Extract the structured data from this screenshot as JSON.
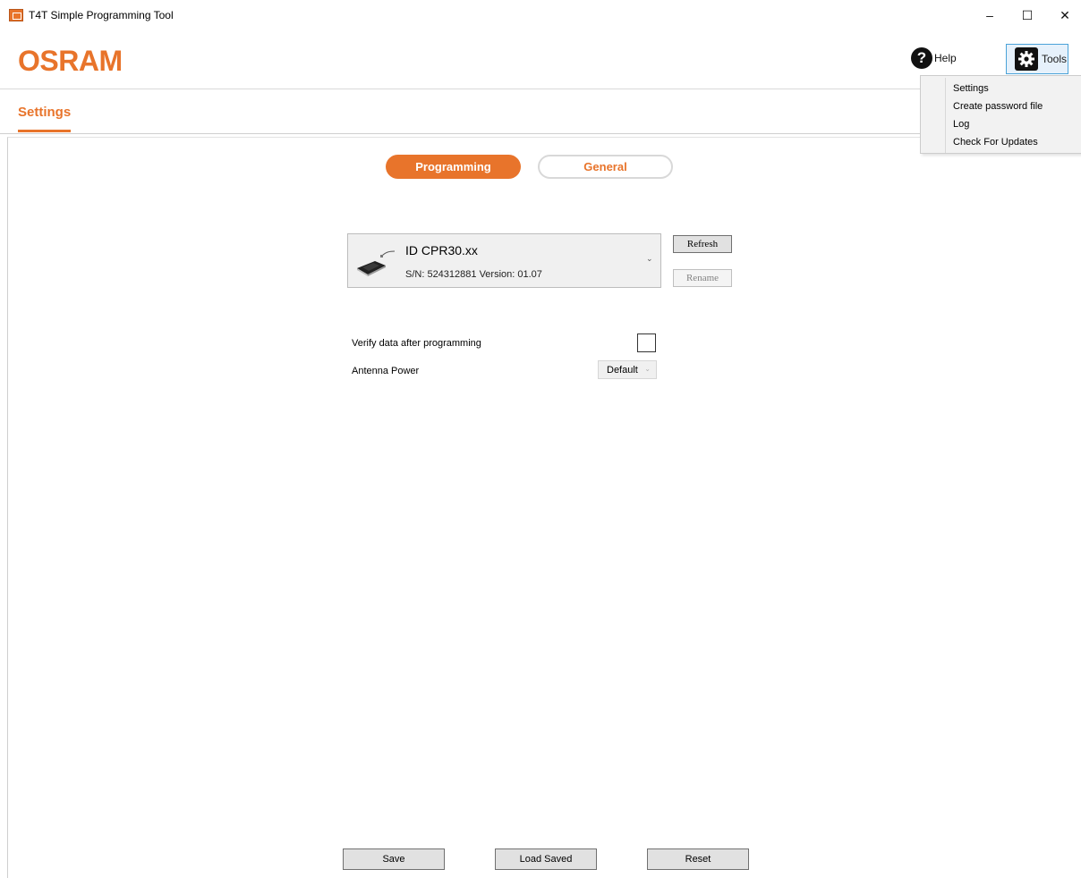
{
  "window": {
    "title": "T4T Simple Programming Tool",
    "controls": {
      "minimize": "–",
      "maximize": "☐",
      "close": "✕"
    }
  },
  "header": {
    "logo": "OSRAM",
    "help_label": "Help",
    "tools_label": "Tools"
  },
  "tools_menu": {
    "items": [
      "Settings",
      "Create password file",
      "Log",
      "Check For Updates"
    ]
  },
  "page": {
    "tab": "Settings"
  },
  "segment": {
    "active": "Programming",
    "inactive": "General"
  },
  "device": {
    "name": "ID CPR30.xx",
    "serial_line": "S/N: 524312881   Version: 01.07",
    "refresh_label": "Refresh",
    "rename_label": "Rename"
  },
  "options": {
    "verify_label": "Verify data after programming",
    "verify_checked": false,
    "antenna_label": "Antenna Power",
    "antenna_value": "Default"
  },
  "footer": {
    "save_label": "Save",
    "load_label": "Load Saved",
    "reset_label": "Reset"
  },
  "colors": {
    "accent": "#e8742b",
    "tools_highlight": "#e6f1fb"
  }
}
